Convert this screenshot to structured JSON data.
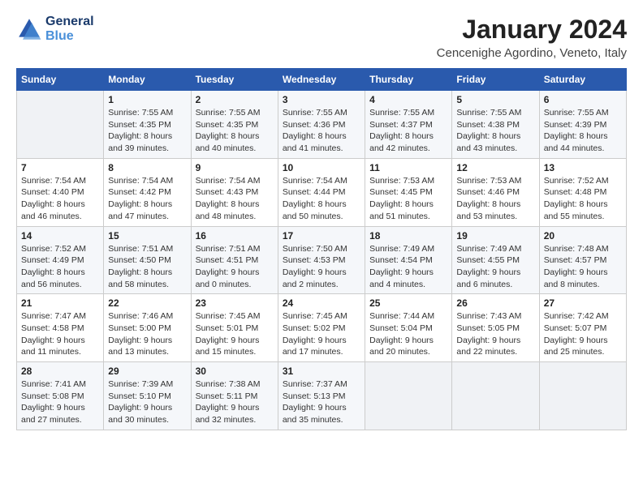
{
  "header": {
    "logo_line1": "General",
    "logo_line2": "Blue",
    "month": "January 2024",
    "location": "Cencenighe Agordino, Veneto, Italy"
  },
  "days_of_week": [
    "Sunday",
    "Monday",
    "Tuesday",
    "Wednesday",
    "Thursday",
    "Friday",
    "Saturday"
  ],
  "weeks": [
    [
      {
        "num": "",
        "info": ""
      },
      {
        "num": "1",
        "info": "Sunrise: 7:55 AM\nSunset: 4:35 PM\nDaylight: 8 hours\nand 39 minutes."
      },
      {
        "num": "2",
        "info": "Sunrise: 7:55 AM\nSunset: 4:35 PM\nDaylight: 8 hours\nand 40 minutes."
      },
      {
        "num": "3",
        "info": "Sunrise: 7:55 AM\nSunset: 4:36 PM\nDaylight: 8 hours\nand 41 minutes."
      },
      {
        "num": "4",
        "info": "Sunrise: 7:55 AM\nSunset: 4:37 PM\nDaylight: 8 hours\nand 42 minutes."
      },
      {
        "num": "5",
        "info": "Sunrise: 7:55 AM\nSunset: 4:38 PM\nDaylight: 8 hours\nand 43 minutes."
      },
      {
        "num": "6",
        "info": "Sunrise: 7:55 AM\nSunset: 4:39 PM\nDaylight: 8 hours\nand 44 minutes."
      }
    ],
    [
      {
        "num": "7",
        "info": "Sunrise: 7:54 AM\nSunset: 4:40 PM\nDaylight: 8 hours\nand 46 minutes."
      },
      {
        "num": "8",
        "info": "Sunrise: 7:54 AM\nSunset: 4:42 PM\nDaylight: 8 hours\nand 47 minutes."
      },
      {
        "num": "9",
        "info": "Sunrise: 7:54 AM\nSunset: 4:43 PM\nDaylight: 8 hours\nand 48 minutes."
      },
      {
        "num": "10",
        "info": "Sunrise: 7:54 AM\nSunset: 4:44 PM\nDaylight: 8 hours\nand 50 minutes."
      },
      {
        "num": "11",
        "info": "Sunrise: 7:53 AM\nSunset: 4:45 PM\nDaylight: 8 hours\nand 51 minutes."
      },
      {
        "num": "12",
        "info": "Sunrise: 7:53 AM\nSunset: 4:46 PM\nDaylight: 8 hours\nand 53 minutes."
      },
      {
        "num": "13",
        "info": "Sunrise: 7:52 AM\nSunset: 4:48 PM\nDaylight: 8 hours\nand 55 minutes."
      }
    ],
    [
      {
        "num": "14",
        "info": "Sunrise: 7:52 AM\nSunset: 4:49 PM\nDaylight: 8 hours\nand 56 minutes."
      },
      {
        "num": "15",
        "info": "Sunrise: 7:51 AM\nSunset: 4:50 PM\nDaylight: 8 hours\nand 58 minutes."
      },
      {
        "num": "16",
        "info": "Sunrise: 7:51 AM\nSunset: 4:51 PM\nDaylight: 9 hours\nand 0 minutes."
      },
      {
        "num": "17",
        "info": "Sunrise: 7:50 AM\nSunset: 4:53 PM\nDaylight: 9 hours\nand 2 minutes."
      },
      {
        "num": "18",
        "info": "Sunrise: 7:49 AM\nSunset: 4:54 PM\nDaylight: 9 hours\nand 4 minutes."
      },
      {
        "num": "19",
        "info": "Sunrise: 7:49 AM\nSunset: 4:55 PM\nDaylight: 9 hours\nand 6 minutes."
      },
      {
        "num": "20",
        "info": "Sunrise: 7:48 AM\nSunset: 4:57 PM\nDaylight: 9 hours\nand 8 minutes."
      }
    ],
    [
      {
        "num": "21",
        "info": "Sunrise: 7:47 AM\nSunset: 4:58 PM\nDaylight: 9 hours\nand 11 minutes."
      },
      {
        "num": "22",
        "info": "Sunrise: 7:46 AM\nSunset: 5:00 PM\nDaylight: 9 hours\nand 13 minutes."
      },
      {
        "num": "23",
        "info": "Sunrise: 7:45 AM\nSunset: 5:01 PM\nDaylight: 9 hours\nand 15 minutes."
      },
      {
        "num": "24",
        "info": "Sunrise: 7:45 AM\nSunset: 5:02 PM\nDaylight: 9 hours\nand 17 minutes."
      },
      {
        "num": "25",
        "info": "Sunrise: 7:44 AM\nSunset: 5:04 PM\nDaylight: 9 hours\nand 20 minutes."
      },
      {
        "num": "26",
        "info": "Sunrise: 7:43 AM\nSunset: 5:05 PM\nDaylight: 9 hours\nand 22 minutes."
      },
      {
        "num": "27",
        "info": "Sunrise: 7:42 AM\nSunset: 5:07 PM\nDaylight: 9 hours\nand 25 minutes."
      }
    ],
    [
      {
        "num": "28",
        "info": "Sunrise: 7:41 AM\nSunset: 5:08 PM\nDaylight: 9 hours\nand 27 minutes."
      },
      {
        "num": "29",
        "info": "Sunrise: 7:39 AM\nSunset: 5:10 PM\nDaylight: 9 hours\nand 30 minutes."
      },
      {
        "num": "30",
        "info": "Sunrise: 7:38 AM\nSunset: 5:11 PM\nDaylight: 9 hours\nand 32 minutes."
      },
      {
        "num": "31",
        "info": "Sunrise: 7:37 AM\nSunset: 5:13 PM\nDaylight: 9 hours\nand 35 minutes."
      },
      {
        "num": "",
        "info": ""
      },
      {
        "num": "",
        "info": ""
      },
      {
        "num": "",
        "info": ""
      }
    ]
  ]
}
